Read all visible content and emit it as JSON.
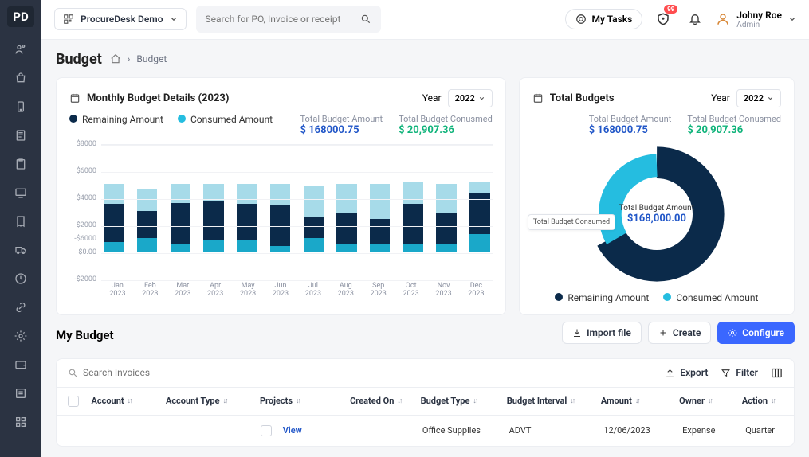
{
  "org": {
    "name": "ProcureDesk Demo"
  },
  "search": {
    "placeholder": "Search for PO, Invoice or receipt"
  },
  "my_tasks_label": "My Tasks",
  "notif_count": "99",
  "user": {
    "name": "Johny Roe",
    "role": "Admin"
  },
  "page": {
    "title": "Budget",
    "crumb_last": "Budget"
  },
  "monthly_card": {
    "title": "Monthly Budget Details (2023)",
    "year_label": "Year",
    "year_value": "2022",
    "legend_remaining": "Remaining Amount",
    "legend_consumed": "Consumed Amount",
    "total_budget_label": "Total Budget Amount",
    "total_budget_value": "$ 168000.75",
    "total_consumed_label": "Total Budget Conusmed",
    "total_consumed_value": "$ 20,907.36"
  },
  "total_card": {
    "title": "Total Budgets",
    "year_label": "Year",
    "year_value": "2022",
    "total_budget_label": "Total Budget Amount",
    "total_budget_value": "$ 168000.75",
    "total_consumed_label": "Total Budget Conusmed",
    "total_consumed_value": "$ 20,907.36",
    "center_label": "Total Budget Amount",
    "center_value": "$168,000.00",
    "slice_label": "Total Budget Consumed",
    "legend_remaining": "Remaining Amount",
    "legend_consumed": "Consumed Amount"
  },
  "my_budget_title": "My Budget",
  "buttons": {
    "import": "Import file",
    "create": "Create",
    "configure": "Configure"
  },
  "table": {
    "search_placeholder": "Search Invoices",
    "export": "Export",
    "filter": "Filter",
    "cols": {
      "account": "Account",
      "account_type": "Account Type",
      "projects": "Projects",
      "created_on": "Created On",
      "budget_type": "Budget Type",
      "budget_interval": "Budget Interval",
      "amount": "Amount",
      "owner": "Owner",
      "action": "Action"
    },
    "row": {
      "view": "View",
      "budget_type": "Office Supplies",
      "budget_interval": "ADVT",
      "amount": "12/06/2023",
      "owner": "Expense",
      "action": "Quarter"
    }
  },
  "chart_data": {
    "type": "bar",
    "title": "Monthly Budget Details (2023)",
    "ylabel": "",
    "ylim": [
      -2000,
      8000
    ],
    "yticks": [
      "$8000",
      "$6000",
      "$4000",
      "$2000",
      "$0.00",
      "-$2000"
    ],
    "yticks_alt": "-$6000",
    "categories": [
      "Jan 2023",
      "Feb 2023",
      "Mar 2023",
      "Apr 2023",
      "May 2023",
      "Jun 2023",
      "Jul 2023",
      "Aug 2023",
      "Sep 2023",
      "Oct 2023",
      "Nov 2023",
      "Dec 2023"
    ],
    "series": [
      {
        "name": "Remaining Amount (light)",
        "values": [
          5000,
          4600,
          5000,
          5000,
          5000,
          5000,
          4800,
          5000,
          5000,
          5200,
          5000,
          5200
        ]
      },
      {
        "name": "Remaining Amount (navy)",
        "values": [
          2800,
          2000,
          3000,
          2800,
          2600,
          3000,
          1600,
          2200,
          1800,
          3000,
          2400,
          3000
        ]
      },
      {
        "name": "Consumed Amount (teal)",
        "values": [
          700,
          1000,
          600,
          900,
          900,
          400,
          1000,
          600,
          600,
          500,
          500,
          1300
        ]
      }
    ]
  },
  "donut_data": {
    "type": "pie",
    "title": "Total Budgets",
    "series": [
      {
        "name": "Remaining Amount",
        "value": 147093.39,
        "color": "#0b2a4a"
      },
      {
        "name": "Consumed Amount",
        "value": 20907.36,
        "color": "#25bde0"
      }
    ],
    "total": 168000.75
  }
}
